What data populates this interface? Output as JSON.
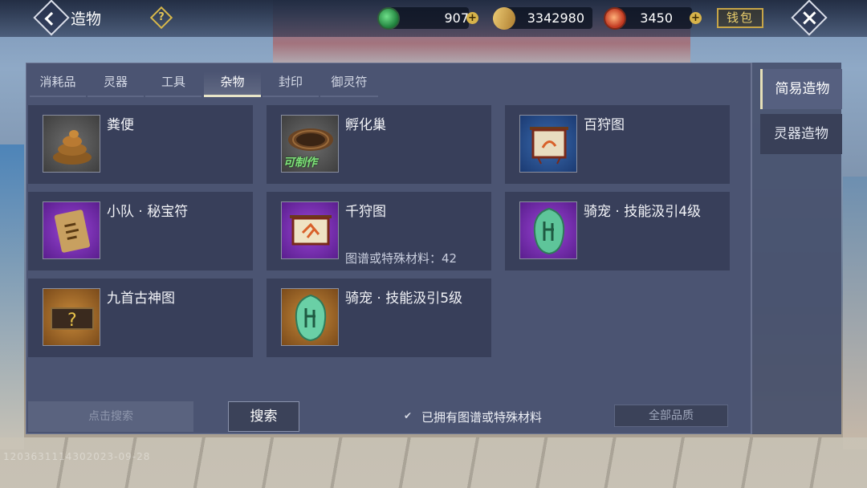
{
  "header": {
    "title": "造物",
    "help_icon": "question-icon",
    "currencies": [
      {
        "icon": "jade-coin-icon",
        "value": "907"
      },
      {
        "icon": "gold-ingot-icon",
        "value": "3342980"
      },
      {
        "icon": "red-orb-icon",
        "value": "3450"
      }
    ],
    "wallet_label": "钱包"
  },
  "tabs": [
    "消耗品",
    "灵器",
    "工具",
    "杂物",
    "封印",
    "御灵符"
  ],
  "active_tab": "杂物",
  "items": [
    {
      "name": "粪便",
      "sub": "",
      "badge": ""
    },
    {
      "name": "孵化巢",
      "sub": "",
      "badge": "可制作"
    },
    {
      "name": "百狩图",
      "sub": "",
      "badge": ""
    },
    {
      "name": "小队 · 秘宝符",
      "sub": "",
      "badge": ""
    },
    {
      "name": "千狩图",
      "sub": "图谱或特殊材料：42",
      "badge": ""
    },
    {
      "name": "骑宠 · 技能汲引4级",
      "sub": "",
      "badge": ""
    },
    {
      "name": "九首古神图",
      "sub": "",
      "badge": ""
    },
    {
      "name": "骑宠 · 技能汲引5级",
      "sub": "",
      "badge": ""
    }
  ],
  "footer": {
    "search_placeholder": "点击搜索",
    "search_button": "搜索",
    "owned_filter_label": "已拥有图谱或特殊材料",
    "owned_filter_checked": true,
    "quality_select": "全部品质"
  },
  "side_tabs": [
    "简易造物",
    "灵器造物"
  ],
  "watermark": "1203631114302023-09-28"
}
